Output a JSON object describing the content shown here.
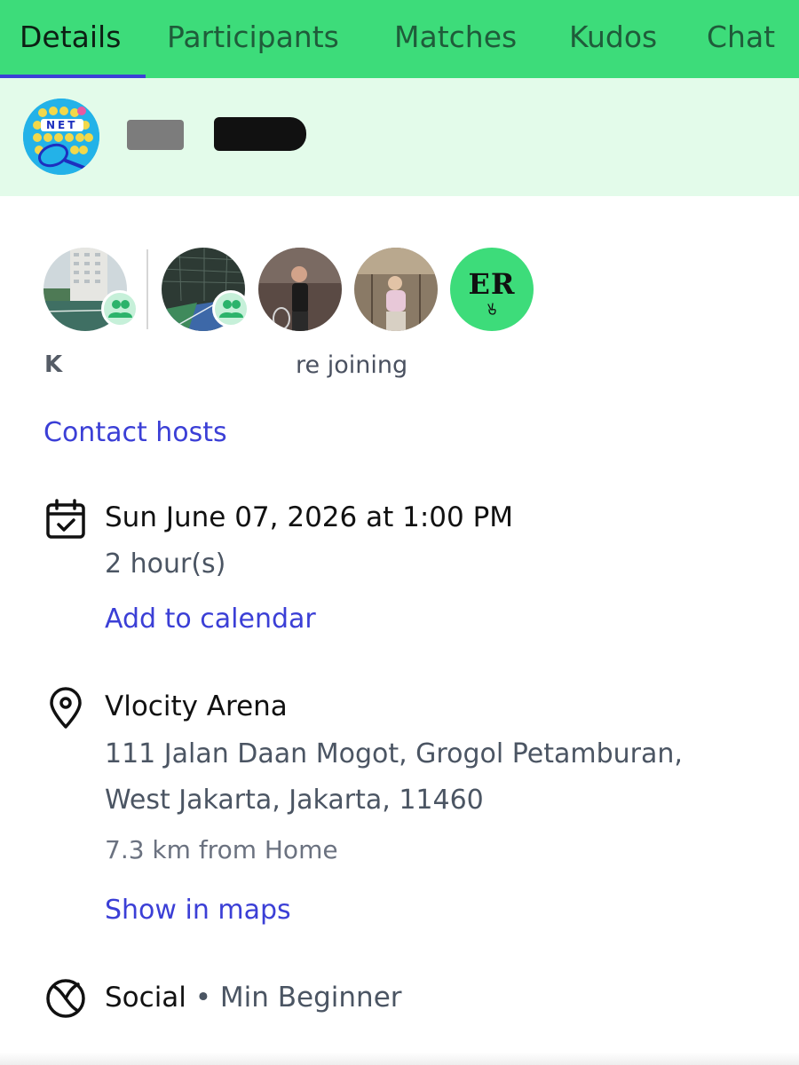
{
  "tabs": [
    {
      "label": "Details",
      "active": true
    },
    {
      "label": "Participants",
      "active": false
    },
    {
      "label": "Matches",
      "active": false
    },
    {
      "label": "Kudos",
      "active": false
    },
    {
      "label": "Chat",
      "active": false
    }
  ],
  "group": {
    "logo_text": "NET",
    "logo_icon": "tennis-racket-icon",
    "name": ""
  },
  "participants": {
    "avatars": [
      {
        "kind": "group-photo",
        "badge": "people-icon"
      },
      {
        "kind": "group-photo",
        "badge": "people-icon"
      },
      {
        "kind": "user-photo"
      },
      {
        "kind": "user-photo"
      },
      {
        "kind": "initials",
        "initials": "ER"
      }
    ],
    "joining_prefix": "K",
    "joining_suffix": "re joining"
  },
  "contact_hosts_label": "Contact hosts",
  "schedule": {
    "icon": "calendar-check-icon",
    "datetime": "Sun June 07, 2026 at 1:00 PM",
    "duration": "2 hour(s)",
    "add_to_calendar_label": "Add to calendar"
  },
  "location": {
    "icon": "map-pin-icon",
    "venue": "Vlocity Arena",
    "address_line1": "111 Jalan Daan Mogot, Grogol Petamburan,",
    "address_line2": "West Jakarta, Jakarta, 11460",
    "distance": "7.3 km from Home",
    "show_in_maps_label": "Show in maps"
  },
  "session": {
    "icon": "tennis-ball-icon",
    "type": "Social",
    "separator": " • ",
    "level": "Min Beginner"
  },
  "colors": {
    "tab_bar": "#3ddc7a",
    "tab_indicator": "#3b3fd6",
    "header_bg": "#e3fbea",
    "link": "#3b3fd6"
  }
}
